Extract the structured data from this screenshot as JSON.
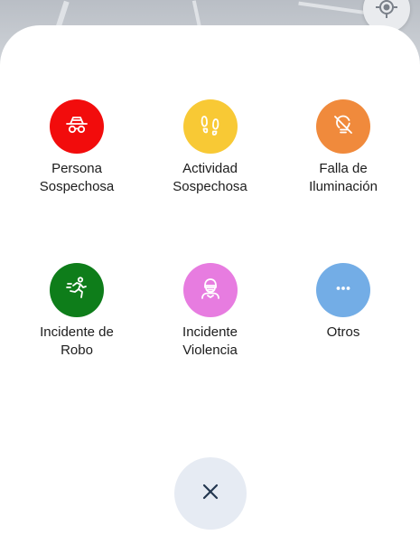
{
  "colors": {
    "persona": "#f20c0c",
    "actividad": "#f8c935",
    "iluminacion": "#f08a3c",
    "robo": "#0e7d1a",
    "violencia": "#e77ce0",
    "otros": "#73ade6",
    "close_bg": "#e6ebf3",
    "close_icon": "#23364f"
  },
  "categories": [
    {
      "label": "Persona\nSospechosa",
      "icon": "hat-glasses-icon"
    },
    {
      "label": "Actividad\nSospechosa",
      "icon": "footprints-icon"
    },
    {
      "label": "Falla de\nIluminación",
      "icon": "lightbulb-off-icon"
    },
    {
      "label": "Incidente de\nRobo",
      "icon": "running-person-icon"
    },
    {
      "label": "Incidente\nViolencia",
      "icon": "masked-person-icon"
    },
    {
      "label": "Otros",
      "icon": "more-dots-icon"
    }
  ],
  "close_button": {
    "icon": "close-icon"
  },
  "map": {
    "icon": "locate-icon"
  }
}
